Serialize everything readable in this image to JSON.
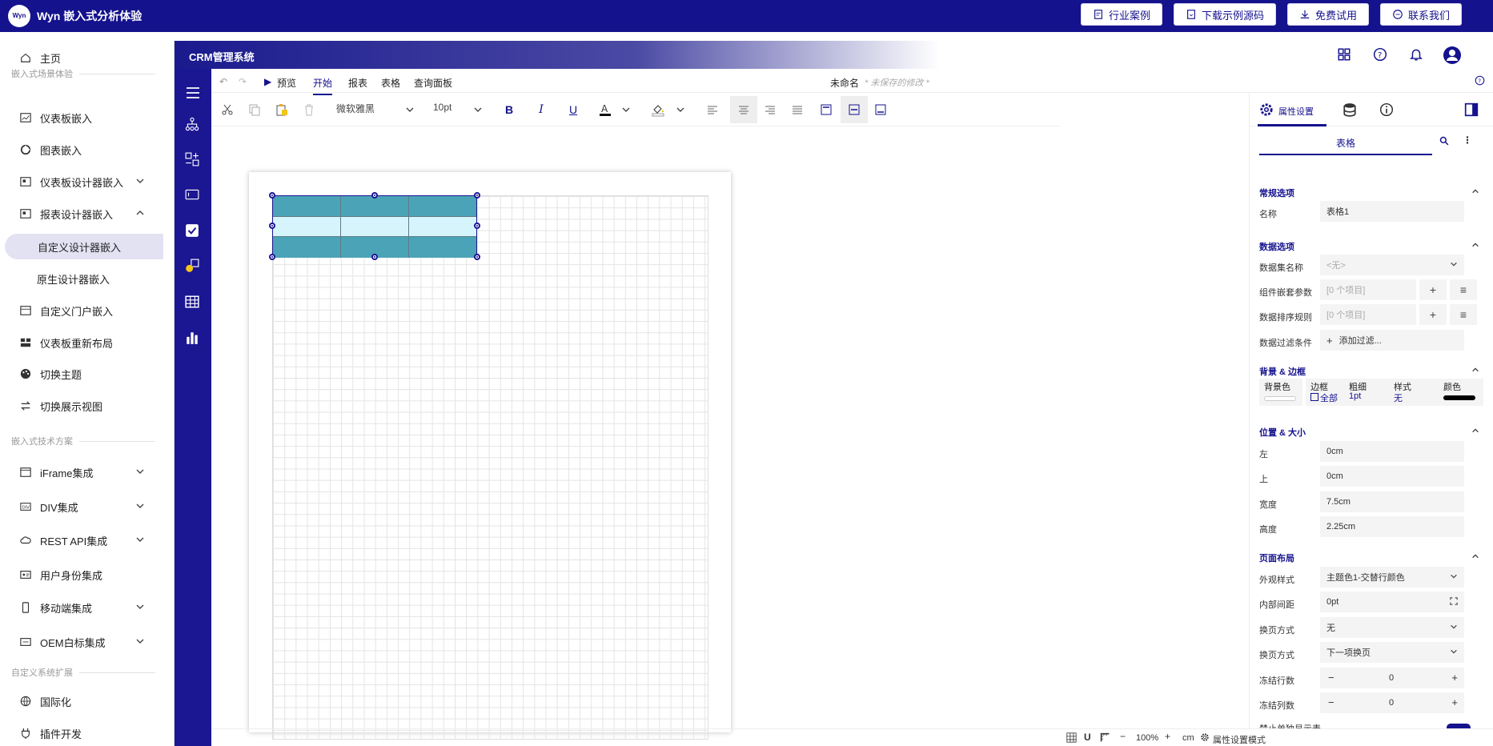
{
  "topbar": {
    "logo_text": "Wyn",
    "brand": "Wyn 嵌入式分析体验",
    "buttons": [
      "行业案例",
      "下载示例源码",
      "免费试用",
      "联系我们"
    ]
  },
  "sidebar": {
    "home": "主页",
    "section1": "嵌入式场景体验",
    "dashboard_embed": "仪表板嵌入",
    "chart_embed": "图表嵌入",
    "dashboard_designer_embed": "仪表板设计器嵌入",
    "report_designer_embed": "报表设计器嵌入",
    "custom_designer_embed": "自定义设计器嵌入",
    "native_designer_embed": "原生设计器嵌入",
    "custom_portal_embed": "自定义门户嵌入",
    "dashboard_relayout": "仪表板重新布局",
    "switch_theme": "切换主题",
    "switch_view": "切换展示视图",
    "section2": "嵌入式技术方案",
    "iframe": "iFrame集成",
    "div": "DIV集成",
    "rest": "REST API集成",
    "identity": "用户身份集成",
    "mobile": "移动端集成",
    "oem": "OEM白标集成",
    "section3": "自定义系统扩展",
    "i18n": "国际化",
    "plugin": "插件开发"
  },
  "app": {
    "title": "CRM管理系统",
    "tabs": {
      "preview": "预览",
      "start": "开始",
      "report": "报表",
      "table": "表格",
      "query": "查询面板"
    },
    "doc_name": "未命名",
    "unsaved": "* 未保存的修改 *",
    "font": "微软雅黑",
    "font_size": "10pt",
    "status": {
      "zoom": "100%",
      "unit": "cm",
      "mode": "属性设置模式"
    }
  },
  "table_component": {
    "rows": 3,
    "cols": 3,
    "header_color": "#4ba3b8",
    "alt_color": "#d6f4fb"
  },
  "panel": {
    "tab_label": "属性设置",
    "title": "表格",
    "general": "常规选项",
    "name_label": "名称",
    "name_value": "表格1",
    "data_options": "数据选项",
    "dataset_label": "数据集名称",
    "dataset_value": "<无>",
    "nested_label": "组件嵌套参数",
    "nested_value": "[0 个项目]",
    "sort_label": "数据排序规则",
    "sort_value": "[0 个项目]",
    "filter_label": "数据过滤条件",
    "filter_value": "添加过滤...",
    "bg_border": "背景 & 边框",
    "bg_color": "背景色",
    "border": "边框",
    "border_all": "全部",
    "thickness": "粗细",
    "thickness_value": "1pt",
    "style": "样式",
    "style_value": "无",
    "color": "颜色",
    "pos_size": "位置 & 大小",
    "left_label": "左",
    "left_value": "0cm",
    "top_label": "上",
    "top_value": "0cm",
    "width_label": "宽度",
    "width_value": "7.5cm",
    "height_label": "高度",
    "height_value": "2.25cm",
    "page_layout": "页面布局",
    "appearance_label": "外观样式",
    "appearance_value": "主题色1-交替行颜色",
    "padding_label": "内部间距",
    "padding_value": "0pt",
    "pagebreak1_label": "换页方式",
    "pagebreak1_value": "无",
    "pagebreak2_label": "换页方式",
    "pagebreak2_value": "下一项换页",
    "freeze_rows_label": "冻结行数",
    "freeze_rows_value": "0",
    "freeze_cols_label": "冻结列数",
    "freeze_cols_value": "0",
    "cut_label": "禁止单独显示表"
  }
}
